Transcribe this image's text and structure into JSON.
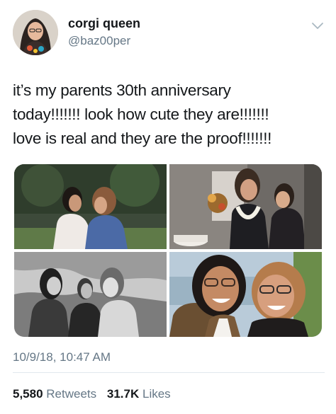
{
  "user": {
    "display_name": "corgi queen",
    "handle": "@baz00per",
    "avatar_icon": "profile-avatar"
  },
  "menu_icon": "chevron-down-icon",
  "tweet": {
    "text": "it’s my parents 30th anniversary\ntoday!!!!!!! look how cute they are!!!!!!!\nlove is real and they are the proof!!!!!!!"
  },
  "media": [
    {
      "name": "photo-1",
      "description": "vintage couple photo outdoors"
    },
    {
      "name": "photo-2",
      "description": "vintage couple photo indoors with cake"
    },
    {
      "name": "photo-3",
      "description": "black and white group photo"
    },
    {
      "name": "photo-4",
      "description": "recent couple selfie"
    }
  ],
  "timestamp": "10/9/18, 10:47 AM",
  "stats": {
    "retweets_count": "5,580",
    "retweets_label": "Retweets",
    "likes_count": "31.7K",
    "likes_label": "Likes"
  },
  "colors": {
    "text": "#14171a",
    "secondary": "#657786",
    "divider": "#e1e8ed"
  }
}
